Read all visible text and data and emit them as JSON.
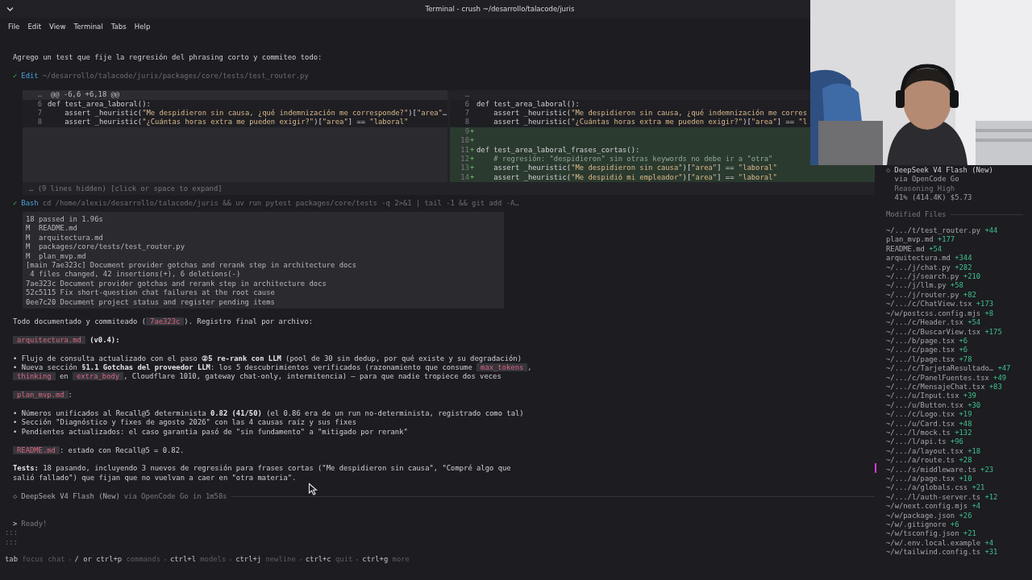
{
  "window": {
    "title": "Terminal - crush ~/desarrollo/talacode/juris"
  },
  "menu": [
    "File",
    "Edit",
    "View",
    "Terminal",
    "Tabs",
    "Help"
  ],
  "intro": "Agrego un test que fije la regresión del phrasing corto y commiteo todo:",
  "edit_tool": {
    "status": "✓",
    "tool": "Edit",
    "detail": "~/desarrollo/talacode/juris/packages/core/tests/test_router.py"
  },
  "diff": {
    "left_fold": "…",
    "hunk": "@@ -6,6 +6,18 @@",
    "right_fold": "…",
    "left_lines": [
      {
        "num": "6",
        "code": "def test_area_laboral():"
      },
      {
        "num": "7",
        "code": "    assert _heuristic(\"Me despidieron sin causa, ¿qué indemnización me corresponde?\")[\"area\"…"
      },
      {
        "num": "8",
        "code": "    assert _heuristic(\"¿Cuántas horas extra me pueden exigir?\")[\"area\"] == \"laboral\""
      }
    ],
    "right_lines": [
      {
        "num": "6",
        "kind": "context",
        "code": "def test_area_laboral():"
      },
      {
        "num": "7",
        "kind": "context",
        "code": "    assert _heuristic(\"Me despidieron sin causa, ¿qué indemnización me corres"
      },
      {
        "num": "8",
        "kind": "context",
        "code": "    assert _heuristic(\"¿Cuántas horas extra me pueden exigir?\")[\"area\"] == \"l"
      },
      {
        "num": "9",
        "kind": "added",
        "sign": "+"
      },
      {
        "num": "10",
        "kind": "added",
        "sign": "+"
      },
      {
        "num": "11",
        "kind": "added",
        "sign": "+",
        "code": "def test_area_laboral_frases_cortas():"
      },
      {
        "num": "12",
        "kind": "comment",
        "sign": "+",
        "code": "    # regresión: \"despidieron\" sin otras keywords no debe ir a \"otra\""
      },
      {
        "num": "13",
        "kind": "added",
        "sign": "+",
        "code": "    assert _heuristic(\"Me despidieron sin causa\")[\"area\"] == \"laboral\""
      },
      {
        "num": "14",
        "kind": "added",
        "sign": "+",
        "code": "    assert _heuristic(\"Me despidió mi empleador\")[\"area\"] == \"laboral\""
      }
    ],
    "hidden_note": "… (9 lines hidden) [click or space to expand]"
  },
  "bash_tool": {
    "status": "✓",
    "tool": "Bash",
    "detail": "cd /home/alexis/desarrollo/talacode/juris && uv run pytest packages/core/tests -q 2>&1 | tail -1 && git add -A…"
  },
  "bash_output": [
    "18 passed in 1.96s",
    "M  README.md",
    "M  arquitectura.md",
    "M  packages/core/tests/test_router.py",
    "M  plan_mvp.md",
    "[main 7ae323c] Document provider gotchas and rerank step in architecture docs",
    " 4 files changed, 42 insertions(+), 6 deletions(-)",
    "7ae323c Document provider gotchas and rerank step in architecture docs",
    "52c5115 Fix short-question chat failures at the root cause",
    "0ee7c20 Document project status and register pending items"
  ],
  "message": [
    {
      "lines": [
        [
          {
            "kind": "text",
            "text": "Todo documentado y commiteado ("
          },
          {
            "kind": "code",
            "text": "7ae323c"
          },
          {
            "kind": "text",
            "text": "). Registro final por archivo:"
          }
        ]
      ]
    },
    {
      "lines": [
        [
          {
            "kind": "code",
            "text": "arquitectura.md"
          },
          {
            "kind": "bold",
            "text": " (v0.4):"
          }
        ]
      ]
    },
    {
      "lines": [
        [
          {
            "kind": "text",
            "text": "• Flujo de consulta actualizado con el paso "
          },
          {
            "kind": "bold",
            "text": "②5 re-rank con LLM"
          },
          {
            "kind": "text",
            "text": " (pool de 30 sin dedup, por qué existe y su degradación)"
          }
        ],
        [
          {
            "kind": "text",
            "text": "• Nueva sección "
          },
          {
            "kind": "bold",
            "text": "§1.1 Gotchas del proveedor LLM"
          },
          {
            "kind": "text",
            "text": ": los 5 descubrimientos verificados (razonamiento que consume "
          },
          {
            "kind": "code",
            "text": "max_tokens"
          },
          {
            "kind": "text",
            "text": ", "
          },
          {
            "kind": "code",
            "text": "thinking"
          },
          {
            "kind": "text",
            "text": " en "
          },
          {
            "kind": "code",
            "text": "extra_body"
          },
          {
            "kind": "text",
            "text": ", Cloudflare 1010, gateway chat-only, intermitencia) — para que nadie tropiece dos veces"
          }
        ]
      ]
    },
    {
      "lines": [
        [
          {
            "kind": "code",
            "text": "plan_mvp.md"
          },
          {
            "kind": "text",
            "text": ":"
          }
        ]
      ]
    },
    {
      "lines": [
        [
          {
            "kind": "text",
            "text": "• Números unificados al Recall@5 determinista "
          },
          {
            "kind": "bold",
            "text": "0.82 (41/50)"
          },
          {
            "kind": "text",
            "text": " (el 0.86 era de un run no-determinista, registrado como tal)"
          }
        ],
        [
          {
            "kind": "text",
            "text": "• Sección \"Diagnóstico y fixes de agosto 2026\" con las 4 causas raíz y sus fixes"
          }
        ],
        [
          {
            "kind": "text",
            "text": "• Pendientes actualizados: el caso garantia pasó de \"sin fundamento\" a \"mitigado por rerank\""
          }
        ]
      ]
    },
    {
      "lines": [
        [
          {
            "kind": "code",
            "text": "README.md"
          },
          {
            "kind": "text",
            "text": ": estado con Recall@5 = 0.82."
          }
        ]
      ]
    },
    {
      "lines": [
        [
          {
            "kind": "bold",
            "text": "Tests:"
          },
          {
            "kind": "text",
            "text": " 18 pasando, incluyendo 3 nuevos de regresión para frases cortas (\"Me despidieron sin causa\", \"Compré algo que salió fallado\") que fijan que no vuelvan a caer en \"otra materia\"."
          }
        ]
      ]
    }
  ],
  "footer": {
    "mark": "◇",
    "model": "DeepSeek V4 Flash (New)",
    "detail": "via OpenCode Go in 1m58s"
  },
  "prompt": {
    "marker": ">",
    "placeholder": "Ready!"
  },
  "gutter": [
    ":::",
    ":::"
  ],
  "hints": [
    {
      "key": "tab",
      "action": "focus chat"
    },
    {
      "key": "/ or ctrl+p",
      "action": "commands"
    },
    {
      "key": "ctrl+l",
      "action": "models"
    },
    {
      "key": "ctrl+j",
      "action": "newline"
    },
    {
      "key": "ctrl+c",
      "action": "quit"
    },
    {
      "key": "ctrl+g",
      "action": "more"
    }
  ],
  "sidebar": {
    "mark": "◇",
    "model": "DeepSeek V4 Flash (New)",
    "provider": "via OpenCode Go",
    "reasoning": "Reasoning High",
    "usage": "41% (414.4K) $5.73",
    "files_heading": "Modified Files",
    "files": [
      {
        "path": "~/.../t/test_router.py",
        "added": "+44"
      },
      {
        "path": "plan_mvp.md",
        "added": "+177"
      },
      {
        "path": "README.md",
        "added": "+54"
      },
      {
        "path": "arquitectura.md",
        "added": "+344"
      },
      {
        "path": "~/.../j/chat.py",
        "added": "+282"
      },
      {
        "path": "~/.../j/search.py",
        "added": "+210"
      },
      {
        "path": "~/.../j/llm.py",
        "added": "+58"
      },
      {
        "path": "~/.../j/router.py",
        "added": "+82"
      },
      {
        "path": "~/.../c/ChatView.tsx",
        "added": "+173"
      },
      {
        "path": "~/w/postcss.config.mjs",
        "added": "+8"
      },
      {
        "path": "~/.../c/Header.tsx",
        "added": "+54"
      },
      {
        "path": "~/.../c/BuscarView.tsx",
        "added": "+175"
      },
      {
        "path": "~/.../b/page.tsx",
        "added": "+6"
      },
      {
        "path": "~/.../c/page.tsx",
        "added": "+6"
      },
      {
        "path": "~/.../l/page.tsx",
        "added": "+78"
      },
      {
        "path": "~/.../c/TarjetaResultado…",
        "added": "+47"
      },
      {
        "path": "~/.../c/PanelFuentes.tsx",
        "added": "+49"
      },
      {
        "path": "~/.../c/MensajeChat.tsx",
        "added": "+83"
      },
      {
        "path": "~/.../u/Input.tsx",
        "added": "+39"
      },
      {
        "path": "~/.../u/Button.tsx",
        "added": "+30"
      },
      {
        "path": "~/.../c/Logo.tsx",
        "added": "+19"
      },
      {
        "path": "~/.../u/Card.tsx",
        "added": "+48"
      },
      {
        "path": "~/.../l/mock.ts",
        "added": "+132"
      },
      {
        "path": "~/.../l/api.ts",
        "added": "+96"
      },
      {
        "path": "~/.../a/layout.tsx",
        "added": "+18"
      },
      {
        "path": "~/.../a/route.ts",
        "added": "+28"
      },
      {
        "path": "~/.../s/middleware.ts",
        "added": "+23"
      },
      {
        "path": "~/.../a/page.tsx",
        "added": "+10"
      },
      {
        "path": "~/.../a/globals.css",
        "added": "+21"
      },
      {
        "path": "~/.../l/auth-server.ts",
        "added": "+12"
      },
      {
        "path": "~/w/next.config.mjs",
        "added": "+4"
      },
      {
        "path": "~/w/package.json",
        "added": "+26"
      },
      {
        "path": "~/w/.gitignore",
        "added": "+6"
      },
      {
        "path": "~/w/tsconfig.json",
        "added": "+21"
      },
      {
        "path": "~/w/.env.local.example",
        "added": "+4"
      },
      {
        "path": "~/w/tailwind.config.ts",
        "added": "+31"
      }
    ]
  }
}
